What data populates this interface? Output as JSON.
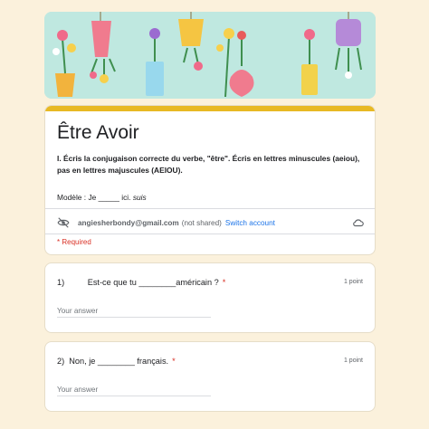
{
  "form": {
    "title": "Être Avoir",
    "description": "I. Écris la conjugaison correcte du verbe, \"être\". Écris en lettres minuscules (aeiou), pas en lettres majuscules (AEIOU).",
    "example_prefix": "Modèle :  Je _____ ici. ",
    "example_answer": "suis",
    "account_email": "angiesherbondy@gmail.com",
    "account_note": "(not shared)",
    "switch_account": "Switch account",
    "required_note": "* Required",
    "theme_color": "#e8b923"
  },
  "questions": [
    {
      "text": "1)          Est-ce que tu ________américain ?",
      "star": "*",
      "points": "1 point",
      "placeholder": "Your answer"
    },
    {
      "text": "2)  Non, je ________ français.",
      "star": "*",
      "points": "1 point",
      "placeholder": "Your answer"
    }
  ],
  "icons": {
    "eye_slash": "eye-slash-icon",
    "cloud": "cloud-icon"
  }
}
